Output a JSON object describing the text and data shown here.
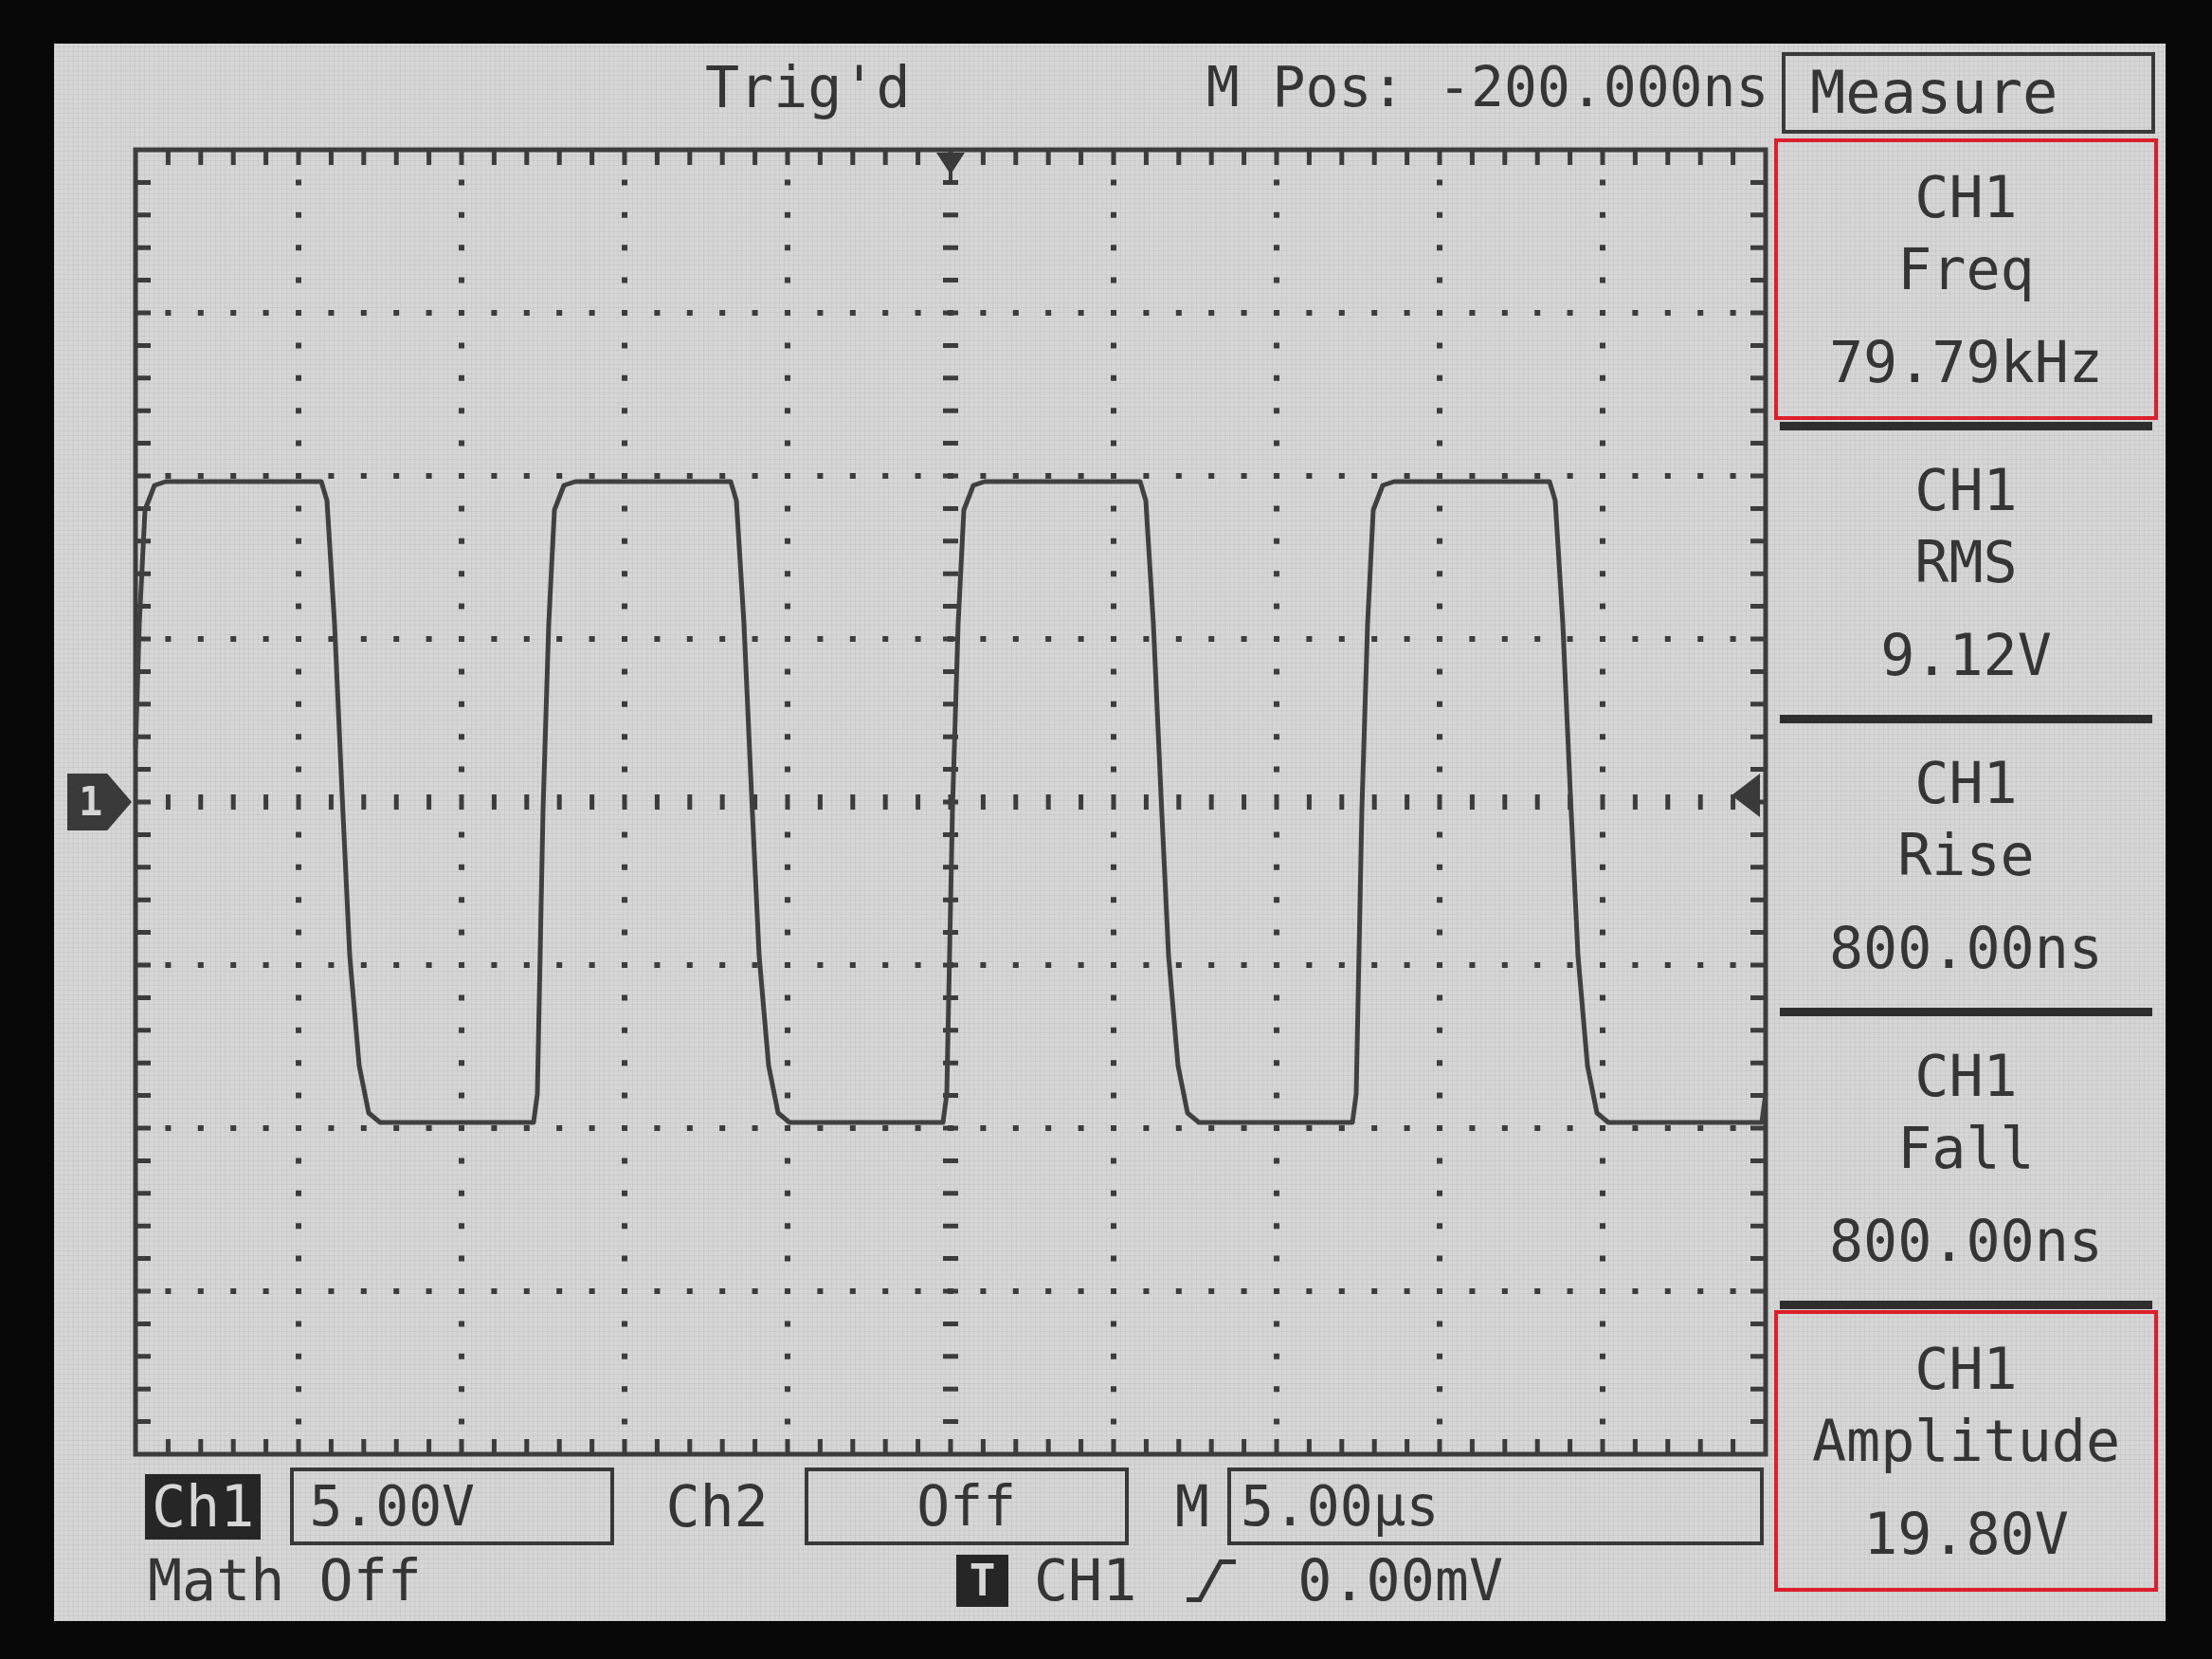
{
  "top_bar": {
    "status": "Trig'd",
    "position": "M Pos: -200.000ns"
  },
  "graticule": {
    "channel_marker": "1"
  },
  "measure_menu": {
    "title": "Measure",
    "items": [
      {
        "channel": "CH1",
        "type": "Freq",
        "value": "79.79kHz",
        "highlighted": true
      },
      {
        "channel": "CH1",
        "type": "RMS",
        "value": "9.12V",
        "highlighted": false
      },
      {
        "channel": "CH1",
        "type": "Rise",
        "value": "800.00ns",
        "highlighted": false
      },
      {
        "channel": "CH1",
        "type": "Fall",
        "value": "800.00ns",
        "highlighted": false
      },
      {
        "channel": "CH1",
        "type": "Amplitude",
        "value": "19.80V",
        "highlighted": true
      }
    ]
  },
  "bottom_bar": {
    "channels": [
      {
        "label": "Ch1",
        "scale": "5.00V",
        "selected": true,
        "on": true
      },
      {
        "label": "Ch2",
        "scale": "Off",
        "selected": false,
        "on": false
      }
    ],
    "timebase": {
      "label": "M",
      "value": "5.00µs"
    },
    "math": "Math Off",
    "trigger": {
      "badge": "T",
      "source": "CH1",
      "level": "0.00mV"
    }
  }
}
